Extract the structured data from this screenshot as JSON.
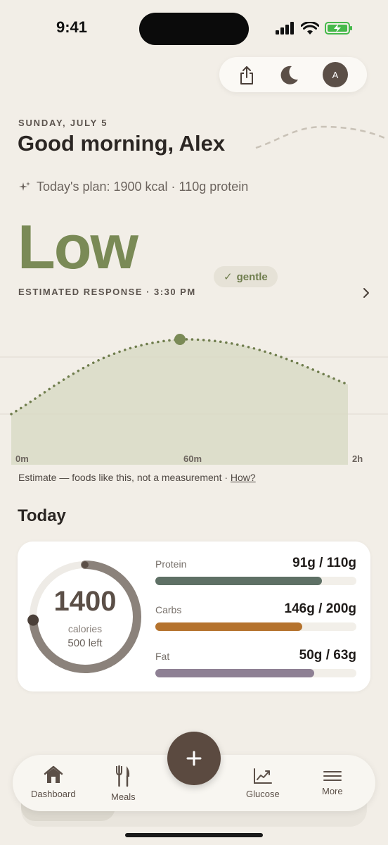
{
  "status_bar": {
    "time": "9:41"
  },
  "header": {
    "avatar_initial": "A",
    "date": "SUNDAY, JULY 5",
    "greeting": "Good morning, Alex",
    "plan": "Today's plan: 1900 kcal · 110g protein"
  },
  "response": {
    "level": "Low",
    "badge": "gentle",
    "estimated_label": "ESTIMATED RESPONSE · 3:30 PM",
    "colors": {
      "level": "#7a8a56",
      "curve": "#6f7d4d",
      "fill": "#d9dbc6"
    }
  },
  "chart_data": {
    "type": "area",
    "x_labels": [
      "0m",
      "60m",
      "2h"
    ],
    "footnote_text": "Estimate — foods like this, not a measurement · ",
    "footnote_link": "How?"
  },
  "today": {
    "title": "Today",
    "calories": {
      "value": "1400",
      "label": "calories",
      "left": "500 left",
      "progress": 0.74
    },
    "macros": [
      {
        "label": "Protein",
        "value": "91g / 110g",
        "fraction": 0.83,
        "color": "#5e7065"
      },
      {
        "label": "Carbs",
        "value": "146g / 200g",
        "fraction": 0.73,
        "color": "#b5732e"
      },
      {
        "label": "Fat",
        "value": "50g / 63g",
        "fraction": 0.79,
        "color": "#8e8094"
      }
    ]
  },
  "nav": {
    "dashboard": "Dashboard",
    "meals": "Meals",
    "glucose": "Glucose",
    "more": "More",
    "add_symbol": "+"
  }
}
